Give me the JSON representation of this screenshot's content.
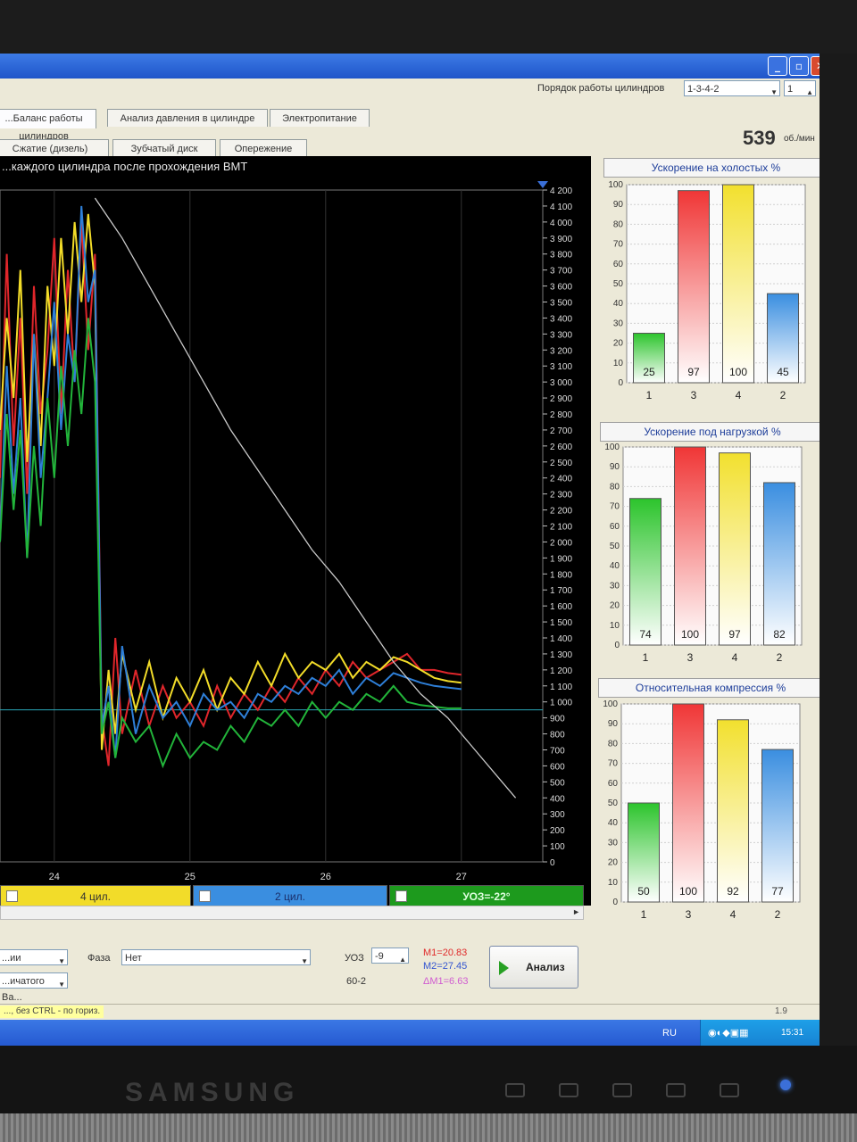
{
  "header": {
    "order_label": "Порядок работы цилиндров",
    "order_value": "1-3-4-2",
    "cyl_value": "1",
    "rpm_value": "539",
    "rpm_unit": "об./мин"
  },
  "tabs_row1": [
    "...Баланс работы цилиндров",
    "Анализ давления в цилиндре",
    "Электропитание"
  ],
  "tabs_row2": [
    "Сжатие (дизель)",
    "Зубчатый диск",
    "Опережение"
  ],
  "main_chart": {
    "title": "...каждого цилиндра после прохождения ВМТ",
    "chart_data": {
      "type": "line",
      "title": "...каждого цилиндра после прохождения ВМТ",
      "xlabel": "",
      "ylabel": "",
      "x_ticks": [
        "24",
        "25",
        "26",
        "27"
      ],
      "y_ticks": [
        "4 200",
        "4 100",
        "4 000",
        "3 900",
        "3 800",
        "3 700",
        "3 600",
        "3 500",
        "3 400",
        "3 300",
        "3 200",
        "3 100",
        "3 000",
        "2 900",
        "2 800",
        "2 700",
        "2 600",
        "2 500",
        "2 400",
        "2 300",
        "2 200",
        "2 100",
        "2 000",
        "1 900",
        "1 800",
        "1 700",
        "1 600",
        "1 500",
        "1 400",
        "1 300",
        "1 200",
        "1 100",
        "1 000",
        "900",
        "800",
        "700",
        "600",
        "500",
        "400",
        "300",
        "200",
        "100",
        "0"
      ],
      "xlim": [
        23.6,
        27.6
      ],
      "ylim": [
        0,
        4200
      ],
      "reference_line": 950,
      "series": [
        {
          "color": "#e0262b",
          "x": [
            23.6,
            23.65,
            23.7,
            23.75,
            23.8,
            23.85,
            23.9,
            23.95,
            24.0,
            24.05,
            24.1,
            24.15,
            24.2,
            24.25,
            24.3,
            24.35,
            24.4,
            24.45,
            24.5,
            24.6,
            24.7,
            24.8,
            24.9,
            25.0,
            25.1,
            25.2,
            25.3,
            25.4,
            25.5,
            25.6,
            25.7,
            25.8,
            25.9,
            26.0,
            26.1,
            26.2,
            26.3,
            26.4,
            26.5,
            26.6,
            26.7,
            26.8,
            26.9,
            27.0
          ],
          "y": [
            2400,
            3800,
            2600,
            3400,
            2300,
            3600,
            2800,
            3200,
            3900,
            2800,
            3700,
            3000,
            4000,
            3200,
            3800,
            900,
            600,
            1400,
            800,
            1200,
            850,
            1100,
            900,
            1000,
            850,
            1100,
            900,
            1050,
            950,
            1100,
            1000,
            1150,
            1050,
            1200,
            1100,
            1250,
            1150,
            1200,
            1250,
            1300,
            1200,
            1200,
            1180,
            1170
          ]
        },
        {
          "color": "#f2dc29",
          "x": [
            23.6,
            23.65,
            23.7,
            23.75,
            23.8,
            23.85,
            23.9,
            23.95,
            24.0,
            24.05,
            24.1,
            24.15,
            24.2,
            24.25,
            24.3,
            24.35,
            24.4,
            24.45,
            24.5,
            24.6,
            24.7,
            24.8,
            24.9,
            25.0,
            25.1,
            25.2,
            25.3,
            25.4,
            25.5,
            25.6,
            25.7,
            25.8,
            25.9,
            26.0,
            26.1,
            26.2,
            26.3,
            26.4,
            26.5,
            26.6,
            26.7,
            26.8,
            26.9,
            27.0
          ],
          "y": [
            2700,
            3400,
            2900,
            3700,
            2500,
            3300,
            2600,
            3600,
            3100,
            3900,
            3300,
            4000,
            3500,
            4050,
            3600,
            700,
            1200,
            800,
            1300,
            950,
            1250,
            900,
            1150,
            1000,
            1200,
            950,
            1150,
            1050,
            1250,
            1100,
            1300,
            1150,
            1250,
            1200,
            1300,
            1150,
            1250,
            1200,
            1280,
            1250,
            1200,
            1150,
            1130,
            1120
          ]
        },
        {
          "color": "#2e7fd8",
          "x": [
            23.6,
            23.65,
            23.7,
            23.75,
            23.8,
            23.85,
            23.9,
            23.95,
            24.0,
            24.05,
            24.1,
            24.15,
            24.2,
            24.25,
            24.3,
            24.35,
            24.4,
            24.45,
            24.5,
            24.6,
            24.7,
            24.8,
            24.9,
            25.0,
            25.1,
            25.2,
            25.3,
            25.4,
            25.5,
            25.6,
            25.7,
            25.8,
            25.9,
            26.0,
            26.1,
            26.2,
            26.3,
            26.4,
            26.5,
            26.6,
            26.7,
            26.8,
            26.9,
            27.0
          ],
          "y": [
            2000,
            3100,
            2300,
            2900,
            1900,
            3300,
            2400,
            2900,
            3500,
            2700,
            3300,
            3000,
            4100,
            3500,
            3700,
            850,
            1100,
            650,
            1350,
            800,
            1100,
            900,
            1000,
            850,
            1050,
            950,
            1000,
            900,
            1050,
            1000,
            1100,
            1050,
            1150,
            1100,
            1200,
            1050,
            1150,
            1100,
            1180,
            1150,
            1120,
            1100,
            1090,
            1080
          ]
        },
        {
          "color": "#22b43a",
          "x": [
            23.6,
            23.65,
            23.7,
            23.75,
            23.8,
            23.85,
            23.9,
            23.95,
            24.0,
            24.05,
            24.1,
            24.15,
            24.2,
            24.25,
            24.3,
            24.35,
            24.4,
            24.45,
            24.5,
            24.6,
            24.7,
            24.8,
            24.9,
            25.0,
            25.1,
            25.2,
            25.3,
            25.4,
            25.5,
            25.6,
            25.7,
            25.8,
            25.9,
            26.0,
            26.1,
            26.2,
            26.3,
            26.4,
            26.5,
            26.6,
            26.7,
            26.8,
            26.9,
            27.0
          ],
          "y": [
            2000,
            2800,
            2200,
            2700,
            1900,
            2600,
            2100,
            2900,
            2400,
            3100,
            2600,
            3200,
            2800,
            3400,
            3000,
            800,
            1000,
            650,
            900,
            750,
            850,
            600,
            800,
            650,
            750,
            700,
            850,
            750,
            900,
            850,
            950,
            850,
            1000,
            900,
            1000,
            950,
            1050,
            1000,
            1100,
            1000,
            980,
            970,
            960,
            960
          ]
        },
        {
          "color": "#c9c9c9",
          "x": [
            24.3,
            24.5,
            24.7,
            24.9,
            25.1,
            25.3,
            25.5,
            25.7,
            25.9,
            26.1,
            26.3,
            26.5,
            26.7,
            26.9,
            27.1,
            27.3,
            27.4
          ],
          "y": [
            4150,
            3900,
            3600,
            3300,
            3000,
            2700,
            2450,
            2200,
            1950,
            1750,
            1500,
            1250,
            1050,
            900,
            700,
            500,
            400
          ]
        }
      ]
    }
  },
  "legend": {
    "items": [
      "4 цил.",
      "2 цил.",
      "УОЗ=-22°"
    ]
  },
  "bar_charts": [
    {
      "title": "Ускорение на холостых %",
      "chart_data": {
        "type": "bar",
        "title": "Ускорение на холостых %",
        "categories": [
          "1",
          "3",
          "4",
          "2"
        ],
        "values": [
          25,
          97,
          100,
          45
        ],
        "value_labels": [
          "25",
          "97",
          "100",
          "45"
        ],
        "ylim": [
          0,
          100
        ],
        "y_ticks": [
          "0",
          "10",
          "20",
          "30",
          "40",
          "50",
          "60",
          "70",
          "80",
          "90",
          "100"
        ],
        "colors": [
          "#2cc42c",
          "#f03636",
          "#f2e02e",
          "#3a8ee0"
        ]
      }
    },
    {
      "title": "Ускорение под нагрузкой %",
      "chart_data": {
        "type": "bar",
        "title": "Ускорение под нагрузкой %",
        "categories": [
          "1",
          "3",
          "4",
          "2"
        ],
        "values": [
          74,
          100,
          97,
          82
        ],
        "value_labels": [
          "74",
          "100",
          "97",
          "82"
        ],
        "ylim": [
          0,
          100
        ],
        "y_ticks": [
          "0",
          "10",
          "20",
          "30",
          "40",
          "50",
          "60",
          "70",
          "80",
          "90",
          "100"
        ],
        "colors": [
          "#2cc42c",
          "#f03636",
          "#f2e02e",
          "#3a8ee0"
        ]
      }
    },
    {
      "title": "Относительная компрессия %",
      "chart_data": {
        "type": "bar",
        "title": "Относительная компрессия %",
        "categories": [
          "1",
          "3",
          "4",
          "2"
        ],
        "values": [
          50,
          100,
          92,
          77
        ],
        "value_labels": [
          "50",
          "100",
          "92",
          "77"
        ],
        "ylim": [
          0,
          100
        ],
        "y_ticks": [
          "0",
          "10",
          "20",
          "30",
          "40",
          "50",
          "60",
          "70",
          "80",
          "90",
          "100"
        ],
        "colors": [
          "#2cc42c",
          "#f03636",
          "#f2e02e",
          "#3a8ee0"
        ]
      }
    }
  ],
  "controls": {
    "left_select1": "...ии",
    "left_select2": "...ичатого Ва...",
    "phase_label": "Фаза",
    "phase_value": "Нет",
    "uoz_label": "УОЗ",
    "uoz_value": "-9",
    "wheel_label": "60-2",
    "m1": "M1=20.83",
    "m2": "M2=27.45",
    "dm1": "ΔM1=6.63",
    "analyze_label": "Анализ"
  },
  "status": {
    "hint": "..., без CTRL - по гориз.",
    "version": "1.9"
  },
  "taskbar": {
    "lang": "RU",
    "time": "15:31"
  },
  "monitor": {
    "brand": "SAMSUNG"
  }
}
